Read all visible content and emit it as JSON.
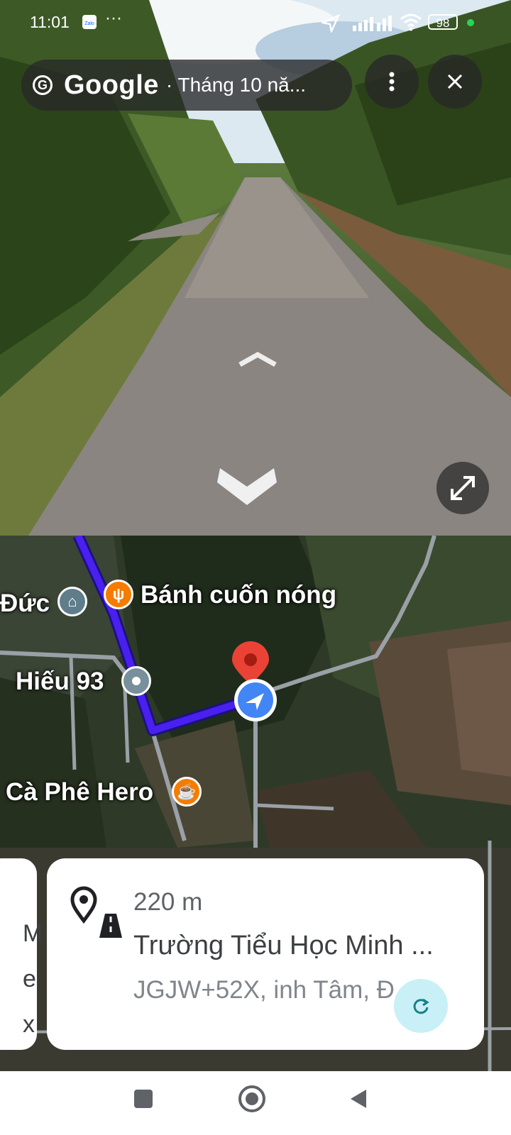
{
  "status_bar": {
    "time": "11:01",
    "battery": "98"
  },
  "street_view": {
    "provider": "Google",
    "date": "· Tháng 10 nă...",
    "icons": [
      "google-g-icon",
      "more-vert-icon",
      "close-icon",
      "chevron-up-icon",
      "chevron-down-icon",
      "expand-icon"
    ]
  },
  "map": {
    "pois": [
      {
        "label": "Bánh cuốn nóng",
        "icon": "restaurant-icon",
        "color": "#f57c00"
      },
      {
        "label": "Đức",
        "icon": "school-icon",
        "color": "#607d8b"
      },
      {
        "label": "Hiếu 93",
        "icon": "place-dot-icon",
        "color": "#78909c"
      },
      {
        "label": "Cà Phê Hero",
        "icon": "coffee-icon",
        "color": "#f57c00"
      }
    ],
    "route_color": "#4a20f0",
    "location_color": "#4285f4",
    "marker_color": "#ea4335"
  },
  "card": {
    "distance": "220 m",
    "title": "Trường Tiểu Học Minh ...",
    "address": "JGJW+52X, inh Tâm, Đ",
    "icons": [
      "place-road-icon",
      "refresh-icon"
    ]
  },
  "left_card_letters": [
    "M",
    "e",
    "x"
  ]
}
